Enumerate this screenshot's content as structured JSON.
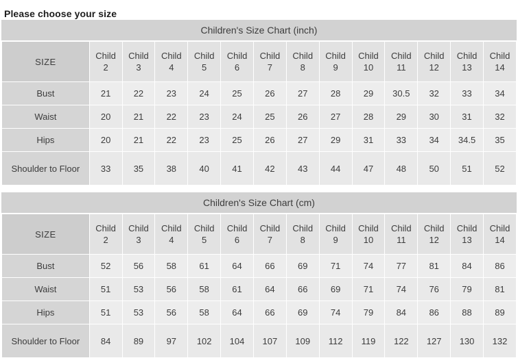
{
  "heading": "Please choose your size",
  "colors": {
    "page_bg": "#ffffff",
    "title_bar": "#d2d2d2",
    "header_label_cell": "#cdcdcd",
    "header_cell": "#e2e2e2",
    "row_label_cell": "#d5d5d5",
    "data_cell": "#ededed",
    "text": "#3c3c3c",
    "heading_text": "#1c1c1c",
    "grid_line": "#ffffff"
  },
  "tables": [
    {
      "title": "Children's Size Chart (inch)",
      "unit": "inch",
      "size_header_label": "SIZE",
      "columns": [
        "Child 2",
        "Child 3",
        "Child 4",
        "Child 5",
        "Child 6",
        "Child 7",
        "Child 8",
        "Child 9",
        "Child 10",
        "Child 11",
        "Child 12",
        "Child 13",
        "Child 14"
      ],
      "column_prefix": "Child",
      "column_numbers": [
        "2",
        "3",
        "4",
        "5",
        "6",
        "7",
        "8",
        "9",
        "10",
        "11",
        "12",
        "13",
        "14"
      ],
      "rows": [
        {
          "label": "Bust",
          "values": [
            "21",
            "22",
            "23",
            "24",
            "25",
            "26",
            "27",
            "28",
            "29",
            "30.5",
            "32",
            "33",
            "34"
          ]
        },
        {
          "label": "Waist",
          "values": [
            "20",
            "21",
            "22",
            "23",
            "24",
            "25",
            "26",
            "27",
            "28",
            "29",
            "30",
            "31",
            "32"
          ]
        },
        {
          "label": "Hips",
          "values": [
            "20",
            "21",
            "22",
            "23",
            "25",
            "26",
            "27",
            "29",
            "31",
            "33",
            "34",
            "34.5",
            "35"
          ]
        },
        {
          "label": "Shoulder to Floor",
          "label_line1": "Shoulder to",
          "label_line2": "Floor",
          "values": [
            "33",
            "35",
            "38",
            "40",
            "41",
            "42",
            "43",
            "44",
            "47",
            "48",
            "50",
            "51",
            "52"
          ]
        }
      ]
    },
    {
      "title": "Children's Size Chart (cm)",
      "unit": "cm",
      "size_header_label": "SIZE",
      "columns": [
        "Child 2",
        "Child 3",
        "Child 4",
        "Child 5",
        "Child 6",
        "Child 7",
        "Child 8",
        "Child 9",
        "Child 10",
        "Child 11",
        "Child 12",
        "Child 13",
        "Child 14"
      ],
      "column_prefix": "Child",
      "column_numbers": [
        "2",
        "3",
        "4",
        "5",
        "6",
        "7",
        "8",
        "9",
        "10",
        "11",
        "12",
        "13",
        "14"
      ],
      "rows": [
        {
          "label": "Bust",
          "values": [
            "52",
            "56",
            "58",
            "61",
            "64",
            "66",
            "69",
            "71",
            "74",
            "77",
            "81",
            "84",
            "86"
          ]
        },
        {
          "label": "Waist",
          "values": [
            "51",
            "53",
            "56",
            "58",
            "61",
            "64",
            "66",
            "69",
            "71",
            "74",
            "76",
            "79",
            "81"
          ]
        },
        {
          "label": "Hips",
          "values": [
            "51",
            "53",
            "56",
            "58",
            "64",
            "66",
            "69",
            "74",
            "79",
            "84",
            "86",
            "88",
            "89"
          ]
        },
        {
          "label": "Shoulder to Floor",
          "label_line1": "Shoulder to",
          "label_line2": "Floor",
          "values": [
            "84",
            "89",
            "97",
            "102",
            "104",
            "107",
            "109",
            "112",
            "119",
            "122",
            "127",
            "130",
            "132"
          ]
        }
      ]
    }
  ]
}
